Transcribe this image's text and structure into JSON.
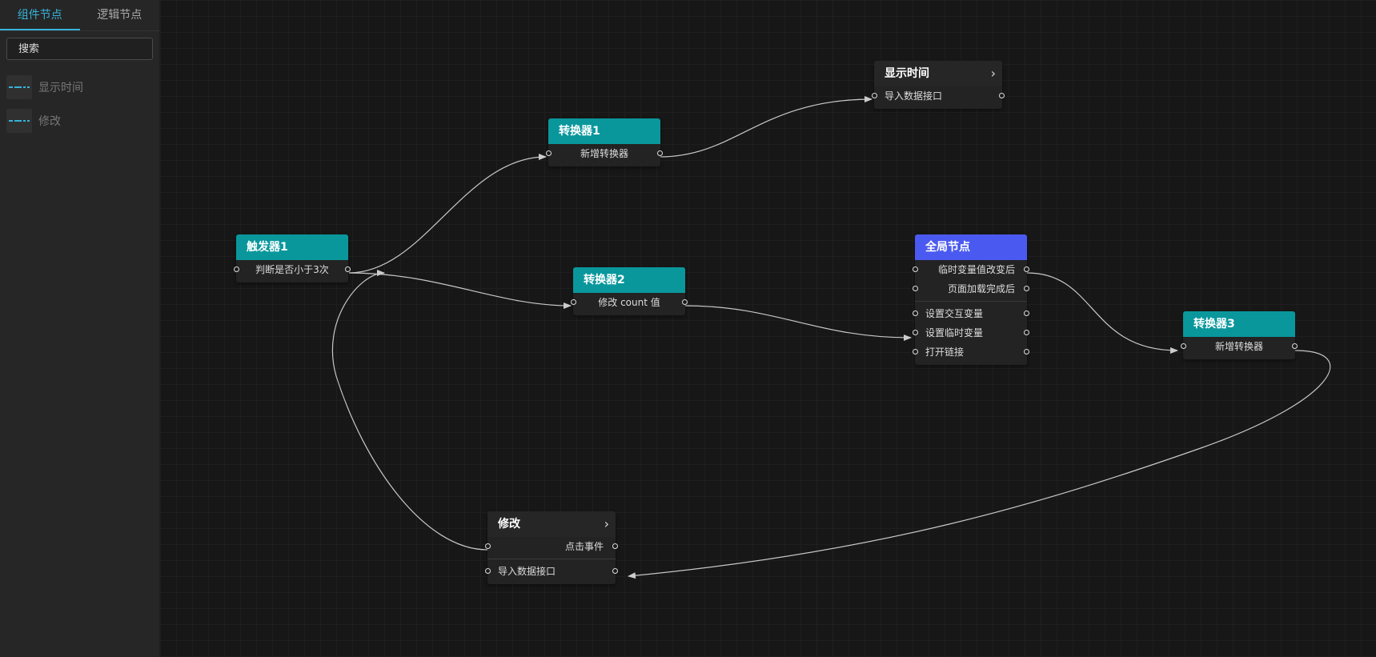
{
  "sidebar": {
    "tabs": [
      {
        "label": "组件节点",
        "active": true
      },
      {
        "label": "逻辑节点",
        "active": false
      }
    ],
    "search_placeholder": "搜索",
    "items": [
      {
        "label": "显示时间",
        "icon": "component-thumbnail-icon"
      },
      {
        "label": "修改",
        "icon": "component-thumbnail-icon"
      }
    ]
  },
  "colors": {
    "accent": "#36b3d9",
    "teal_header": "#09979c",
    "global_header": "#4a5af0",
    "component_header": "#262626",
    "edge": "#cccccc"
  },
  "nodes": {
    "trigger1": {
      "title": "触发器1",
      "rows": [
        "判断是否小于3次"
      ]
    },
    "converter1": {
      "title": "转换器1",
      "rows": [
        "新增转换器"
      ]
    },
    "converter2": {
      "title": "转换器2",
      "rows": [
        "修改 count 值"
      ]
    },
    "converter3": {
      "title": "转换器3",
      "rows": [
        "新增转换器"
      ]
    },
    "show_time": {
      "title": "显示时间",
      "rows": [
        "导入数据接口"
      ]
    },
    "global": {
      "title": "全局节点",
      "rows_top": [
        "临时变量值改变后",
        "页面加载完成后"
      ],
      "rows_bottom": [
        "设置交互变量",
        "设置临时变量",
        "打开链接"
      ]
    },
    "modify": {
      "title": "修改",
      "rows": [
        "点击事件",
        "导入数据接口"
      ]
    }
  }
}
